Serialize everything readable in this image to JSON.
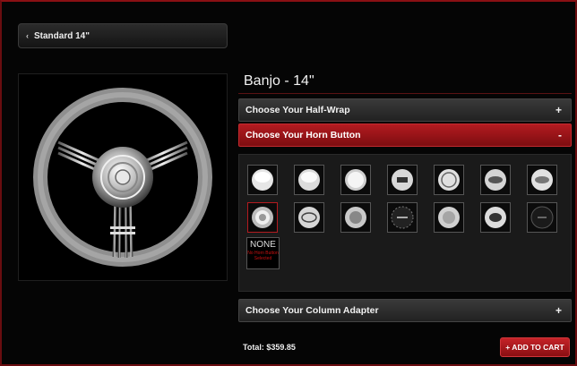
{
  "header": {
    "back_label": "Standard 14\"",
    "back_icon": "chevron-left-icon"
  },
  "product": {
    "title": "Banjo - 14\""
  },
  "sections": {
    "half_wrap": {
      "label": "Choose Your Half-Wrap",
      "toggle": "+"
    },
    "horn_button": {
      "label": "Choose Your Horn Button",
      "toggle": "-"
    },
    "column_adapter": {
      "label": "Choose Your Column Adapter",
      "toggle": "+"
    }
  },
  "horn_options": {
    "none_label": "NONE",
    "none_sub": "No Horn Button Selected"
  },
  "cart": {
    "total": "Total: $359.85",
    "add_label": "+ ADD TO CART"
  },
  "colors": {
    "accent": "#b31b20",
    "border": "#6a0d10"
  }
}
